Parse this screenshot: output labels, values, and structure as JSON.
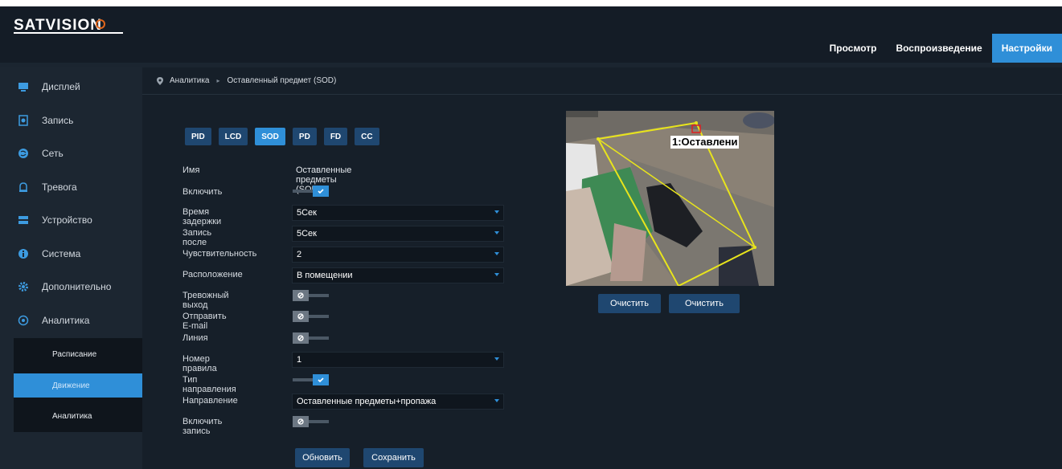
{
  "topnav": {
    "items": [
      {
        "label": "Просмотр",
        "active": false
      },
      {
        "label": "Воспроизведение",
        "active": false
      },
      {
        "label": "Настройки",
        "active": true
      }
    ]
  },
  "sidebar": {
    "items": [
      {
        "label": "Дисплей",
        "icon": "display-icon"
      },
      {
        "label": "Запись",
        "icon": "record-icon"
      },
      {
        "label": "Сеть",
        "icon": "network-icon"
      },
      {
        "label": "Тревога",
        "icon": "alarm-icon"
      },
      {
        "label": "Устройство",
        "icon": "device-icon"
      },
      {
        "label": "Система",
        "icon": "info-icon"
      },
      {
        "label": "Дополнительно",
        "icon": "gear-icon"
      },
      {
        "label": "Аналитика",
        "icon": "analytics-icon"
      }
    ],
    "submenu": [
      {
        "label": "Расписание",
        "active": false
      },
      {
        "label": "Движение",
        "active": true
      },
      {
        "label": "Аналитика",
        "active": false
      }
    ]
  },
  "breadcrumb": {
    "parent": "Аналитика",
    "separator": "▸",
    "current": "Оставленный предмет (SOD)"
  },
  "tabs": [
    {
      "label": "PID",
      "active": false
    },
    {
      "label": "LCD",
      "active": false
    },
    {
      "label": "SOD",
      "active": true
    },
    {
      "label": "PD",
      "active": false
    },
    {
      "label": "FD",
      "active": false
    },
    {
      "label": "CC",
      "active": false
    }
  ],
  "form": {
    "name_label": "Имя",
    "name_value": "Оставленные предметы (SOD)",
    "enable_label": "Включить",
    "enable_on": true,
    "delay_label": "Время задержки",
    "delay_value": "5Сек",
    "post_record_label": "Запись после",
    "post_record_value": "5Сек",
    "sensitivity_label": "Чувствительность",
    "sensitivity_value": "2",
    "location_label": "Расположение",
    "location_value": "В помещении",
    "alarm_out_label": "Тревожный выход",
    "alarm_out_on": false,
    "email_label": "Отправить E-mail",
    "email_on": false,
    "line_label": "Линия",
    "line_on": false,
    "rule_label": "Номер правила",
    "rule_value": "1",
    "direction_type_label": "Тип направления",
    "direction_type_on": true,
    "direction_label": "Направление",
    "direction_value": "Оставленные предметы+пропажа",
    "record_enable_label": "Включить запись",
    "record_enable_on": false
  },
  "buttons": {
    "refresh": "Обновить",
    "save": "Сохранить",
    "clear1": "Очистить",
    "clear2": "Очистить"
  },
  "preview": {
    "overlay_label": "1:Оставлени",
    "line_color": "#e8e41c",
    "box_color": "#e02020"
  },
  "colors": {
    "accent": "#2f8fd8",
    "button": "#1f4770",
    "background": "#161f29"
  }
}
